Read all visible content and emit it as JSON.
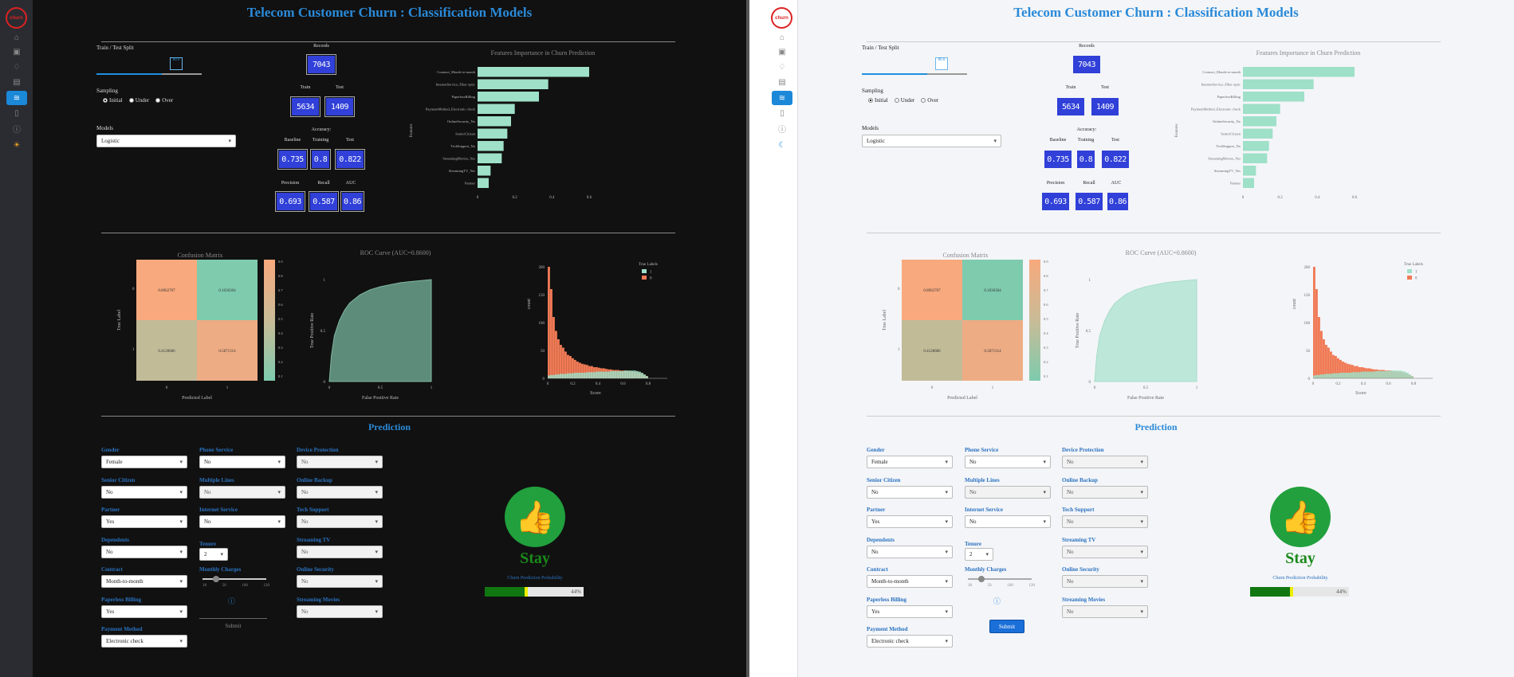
{
  "page": {
    "title": "Telecom Customer Churn : Classification Models"
  },
  "nav": {
    "logo_text": "churn",
    "items": [
      "home-icon",
      "contacts-icon",
      "bulb-icon",
      "table-icon",
      "models-icon",
      "document-icon",
      "info-icon"
    ],
    "dark_theme_icon": "sun-icon",
    "light_theme_icon": "moon-icon"
  },
  "controls": {
    "split_label": "Train / Test Split",
    "split_handle": "80.0",
    "split_value": 80,
    "sampling_label": "Sampling",
    "sampling_options": [
      "Initial",
      "Under",
      "Over"
    ],
    "sampling_selected": "Initial",
    "models_label": "Models",
    "models_value": "Logistic"
  },
  "stats": {
    "records_label": "Records",
    "records": "7043",
    "train_label": "Train",
    "train": "5634",
    "test_label": "Test",
    "test": "1409",
    "accuracy_label": "Accuracy:",
    "baseline_label": "Baseline",
    "baseline": "0.735",
    "training_label": "Training",
    "training": "0.8",
    "testacc_label": "Test",
    "testacc": "0.822",
    "precision_label": "Precision",
    "precision": "0.693",
    "recall_label": "Recall",
    "recall": "0.587",
    "auc_label": "AUC",
    "auc": "0.86"
  },
  "charts": {
    "fi_title": "Features Importance in Churn Prediction",
    "fi_ylabel": "Features",
    "cm_title": "Confusion Matrix",
    "cm_xlabel": "Predicted Label",
    "cm_ylabel": "True Label",
    "roc_title": "ROC Curve (AUC=0.8600)",
    "roc_xlabel": "False Positive Rate",
    "roc_ylabel": "True Positive Rate",
    "hist_xlabel": "Score",
    "hist_ylabel": "count",
    "hist_legend_title": "True Labels",
    "hist_legend": [
      "1",
      "0"
    ]
  },
  "chart_data": [
    {
      "type": "bar",
      "orientation": "horizontal",
      "title": "Features Importance in Churn Prediction",
      "ylabel": "Features",
      "categories": [
        "Contract_Month-to-month",
        "InternetService_Fiber optic",
        "PaperlessBilling",
        "PaymentMethod_Electronic check",
        "OnlineSecurity_No",
        "SeniorCitizen",
        "TechSupport_No",
        "StreamingMovies_Yes",
        "StreamingTV_Yes",
        "Partner"
      ],
      "values": [
        0.6,
        0.38,
        0.33,
        0.2,
        0.18,
        0.16,
        0.14,
        0.13,
        0.07,
        0.06
      ],
      "xlim": [
        0,
        0.6
      ],
      "xticks": [
        "0",
        "0.2",
        "0.4",
        "0.6"
      ]
    },
    {
      "type": "heatmap",
      "title": "Confusion Matrix",
      "xlabel": "Predicted Label",
      "ylabel": "True Label",
      "xcategories": [
        "0",
        "1"
      ],
      "ycategories": [
        "0",
        "1"
      ],
      "values": [
        [
          "0.8962707",
          "0.1036304"
        ],
        [
          "0.4128686",
          "0.5871314"
        ]
      ],
      "colorbar_ticks": [
        "0.9",
        "0.8",
        "0.7",
        "0.6",
        "0.5",
        "0.4",
        "0.3",
        "0.2",
        "0.1"
      ]
    },
    {
      "type": "area",
      "title": "ROC Curve (AUC=0.8600)",
      "xlabel": "False Positive Rate",
      "ylabel": "True Positive Rate",
      "x": [
        0,
        0.02,
        0.05,
        0.1,
        0.15,
        0.2,
        0.3,
        0.4,
        0.5,
        0.6,
        0.7,
        0.8,
        0.9,
        1.0
      ],
      "y": [
        0,
        0.25,
        0.45,
        0.6,
        0.7,
        0.77,
        0.85,
        0.9,
        0.93,
        0.95,
        0.97,
        0.98,
        0.99,
        1.0
      ],
      "xticks": [
        "0",
        "0.5",
        "1"
      ],
      "yticks": [
        "0",
        "0.5",
        "1"
      ]
    },
    {
      "type": "bar",
      "title": "",
      "xlabel": "Score",
      "ylabel": "count",
      "legend_title": "True Labels",
      "series": [
        {
          "name": "0",
          "values": [
            200,
            160,
            110,
            85,
            70,
            60,
            55,
            48,
            42,
            40,
            36,
            33,
            30,
            28,
            26,
            25,
            24,
            22,
            22,
            20,
            20,
            19,
            18,
            18,
            17,
            16,
            16,
            15,
            15,
            15,
            14,
            14,
            14,
            13,
            13,
            12,
            12,
            11,
            10,
            8,
            6,
            4
          ]
        },
        {
          "name": "1",
          "values": [
            5,
            6,
            6,
            7,
            7,
            8,
            8,
            8,
            9,
            9,
            9,
            10,
            10,
            10,
            10,
            10,
            11,
            11,
            11,
            11,
            12,
            12,
            12,
            12,
            12,
            12,
            13,
            13,
            13,
            13,
            13,
            13,
            14,
            14,
            14,
            14,
            14,
            13,
            12,
            10,
            7,
            4
          ]
        }
      ],
      "xticks": [
        "0",
        "0.2",
        "0.4",
        "0.6",
        "0.8"
      ],
      "yticks": [
        "0",
        "50",
        "100",
        "150",
        "200"
      ]
    }
  ],
  "prediction": {
    "title": "Prediction",
    "col1": [
      {
        "label": "Gender",
        "value": "Female",
        "disabled": false
      },
      {
        "label": "Senior Citizen",
        "value": "No",
        "disabled": false
      },
      {
        "label": "Partner",
        "value": "Yes",
        "disabled": false
      },
      {
        "label": "Dependents",
        "value": "No",
        "disabled": false
      },
      {
        "label": "Contract",
        "value": "Month-to-month",
        "disabled": false
      },
      {
        "label": "Paperless Billing",
        "value": "Yes",
        "disabled": false
      },
      {
        "label": "Payment Method",
        "value": "Electronic check",
        "disabled": false
      }
    ],
    "col2": [
      {
        "label": "Phone Service",
        "value": "No",
        "disabled": false
      },
      {
        "label": "Multiple Lines",
        "value": "No",
        "disabled": true
      },
      {
        "label": "Internet Service",
        "value": "No",
        "disabled": false
      }
    ],
    "col3": [
      {
        "label": "Device Protection",
        "value": "No",
        "disabled": true
      },
      {
        "label": "Online Backup",
        "value": "No",
        "disabled": true
      },
      {
        "label": "Tech Support",
        "value": "No",
        "disabled": true
      },
      {
        "label": "Streaming TV",
        "value": "No",
        "disabled": true
      },
      {
        "label": "Online Security",
        "value": "No",
        "disabled": true
      },
      {
        "label": "Streaming Movies",
        "value": "No",
        "disabled": true
      }
    ],
    "tenure_label": "Tenure",
    "tenure_value": "2",
    "monthly_label": "Monthly Charges",
    "monthly_ticks": [
      "18",
      "50",
      "100",
      "120"
    ],
    "info_icon": "info-icon",
    "submit_label": "Submit",
    "result": "Stay",
    "prob_label": "Churn Prediction Probability",
    "prob_value": "44%",
    "prob_fraction": 0.44,
    "result_icon": "thumbs-up-icon"
  },
  "colors": {
    "accent": "#2a8ad8",
    "led": "#3040d8",
    "mint": "#9ee0c8",
    "salmon": "#f07a55",
    "green": "#1a8a1a",
    "dark_bg": "#111111",
    "light_bg": "#f4f5f8"
  }
}
